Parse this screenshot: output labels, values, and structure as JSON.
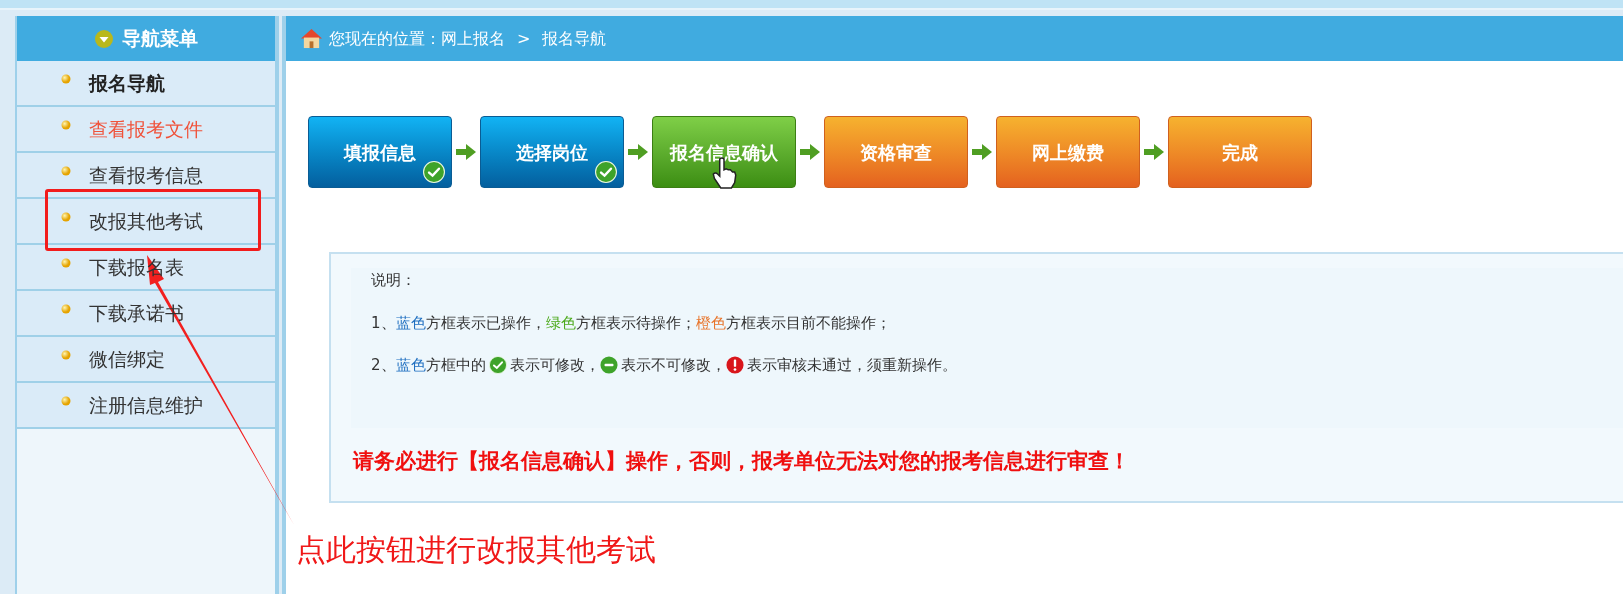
{
  "sidebar": {
    "title": "导航菜单",
    "items": [
      {
        "label": "报名导航",
        "selected": true,
        "highlighted": false
      },
      {
        "label": "查看报考文件",
        "selected": false,
        "highlighted": true
      },
      {
        "label": "查看报考信息",
        "selected": false,
        "highlighted": false
      },
      {
        "label": "改报其他考试",
        "selected": false,
        "highlighted": false
      },
      {
        "label": "下载报名表",
        "selected": false,
        "highlighted": false
      },
      {
        "label": "下载承诺书",
        "selected": false,
        "highlighted": false
      },
      {
        "label": "微信绑定",
        "selected": false,
        "highlighted": false
      },
      {
        "label": "注册信息维护",
        "selected": false,
        "highlighted": false
      }
    ]
  },
  "breadcrumb": {
    "prefix": "您现在的位置：网上报名",
    "separator": ">",
    "current": "报名导航"
  },
  "steps": [
    {
      "label": "填报信息",
      "kind": "done",
      "checked": true,
      "pointer": false
    },
    {
      "label": "选择岗位",
      "kind": "done",
      "checked": true,
      "pointer": false
    },
    {
      "label": "报名信息确认",
      "kind": "current",
      "checked": false,
      "pointer": true
    },
    {
      "label": "资格审查",
      "kind": "locked",
      "checked": false,
      "pointer": false
    },
    {
      "label": "网上缴费",
      "kind": "locked",
      "checked": false,
      "pointer": false
    },
    {
      "label": "完成",
      "kind": "locked",
      "checked": false,
      "pointer": false
    }
  ],
  "notice": {
    "title": "说明：",
    "lines": [
      [
        {
          "kind": "text",
          "text": "1、"
        },
        {
          "kind": "text",
          "text": "蓝色",
          "color": "#1f6fc0"
        },
        {
          "kind": "text",
          "text": "方框表示已操作，"
        },
        {
          "kind": "text",
          "text": "绿色",
          "color": "#4caa1c"
        },
        {
          "kind": "text",
          "text": "方框表示待操作；"
        },
        {
          "kind": "text",
          "text": "橙色",
          "color": "#e8742a"
        },
        {
          "kind": "text",
          "text": "方框表示目前不能操作；"
        }
      ],
      [
        {
          "kind": "text",
          "text": "2、"
        },
        {
          "kind": "text",
          "text": "蓝色",
          "color": "#1f6fc0"
        },
        {
          "kind": "text",
          "text": "方框中的"
        },
        {
          "kind": "ok"
        },
        {
          "kind": "text",
          "text": "表示可修改，"
        },
        {
          "kind": "no"
        },
        {
          "kind": "text",
          "text": "表示不可修改，"
        },
        {
          "kind": "alert"
        },
        {
          "kind": "text",
          "text": "表示审核未通过，须重新操作。"
        }
      ]
    ],
    "warning": "请务必进行【报名信息确认】操作，否则，报考单位无法对您的报考信息进行审查！"
  },
  "annotation": {
    "text": "点此按钮进行改报其他考试"
  }
}
